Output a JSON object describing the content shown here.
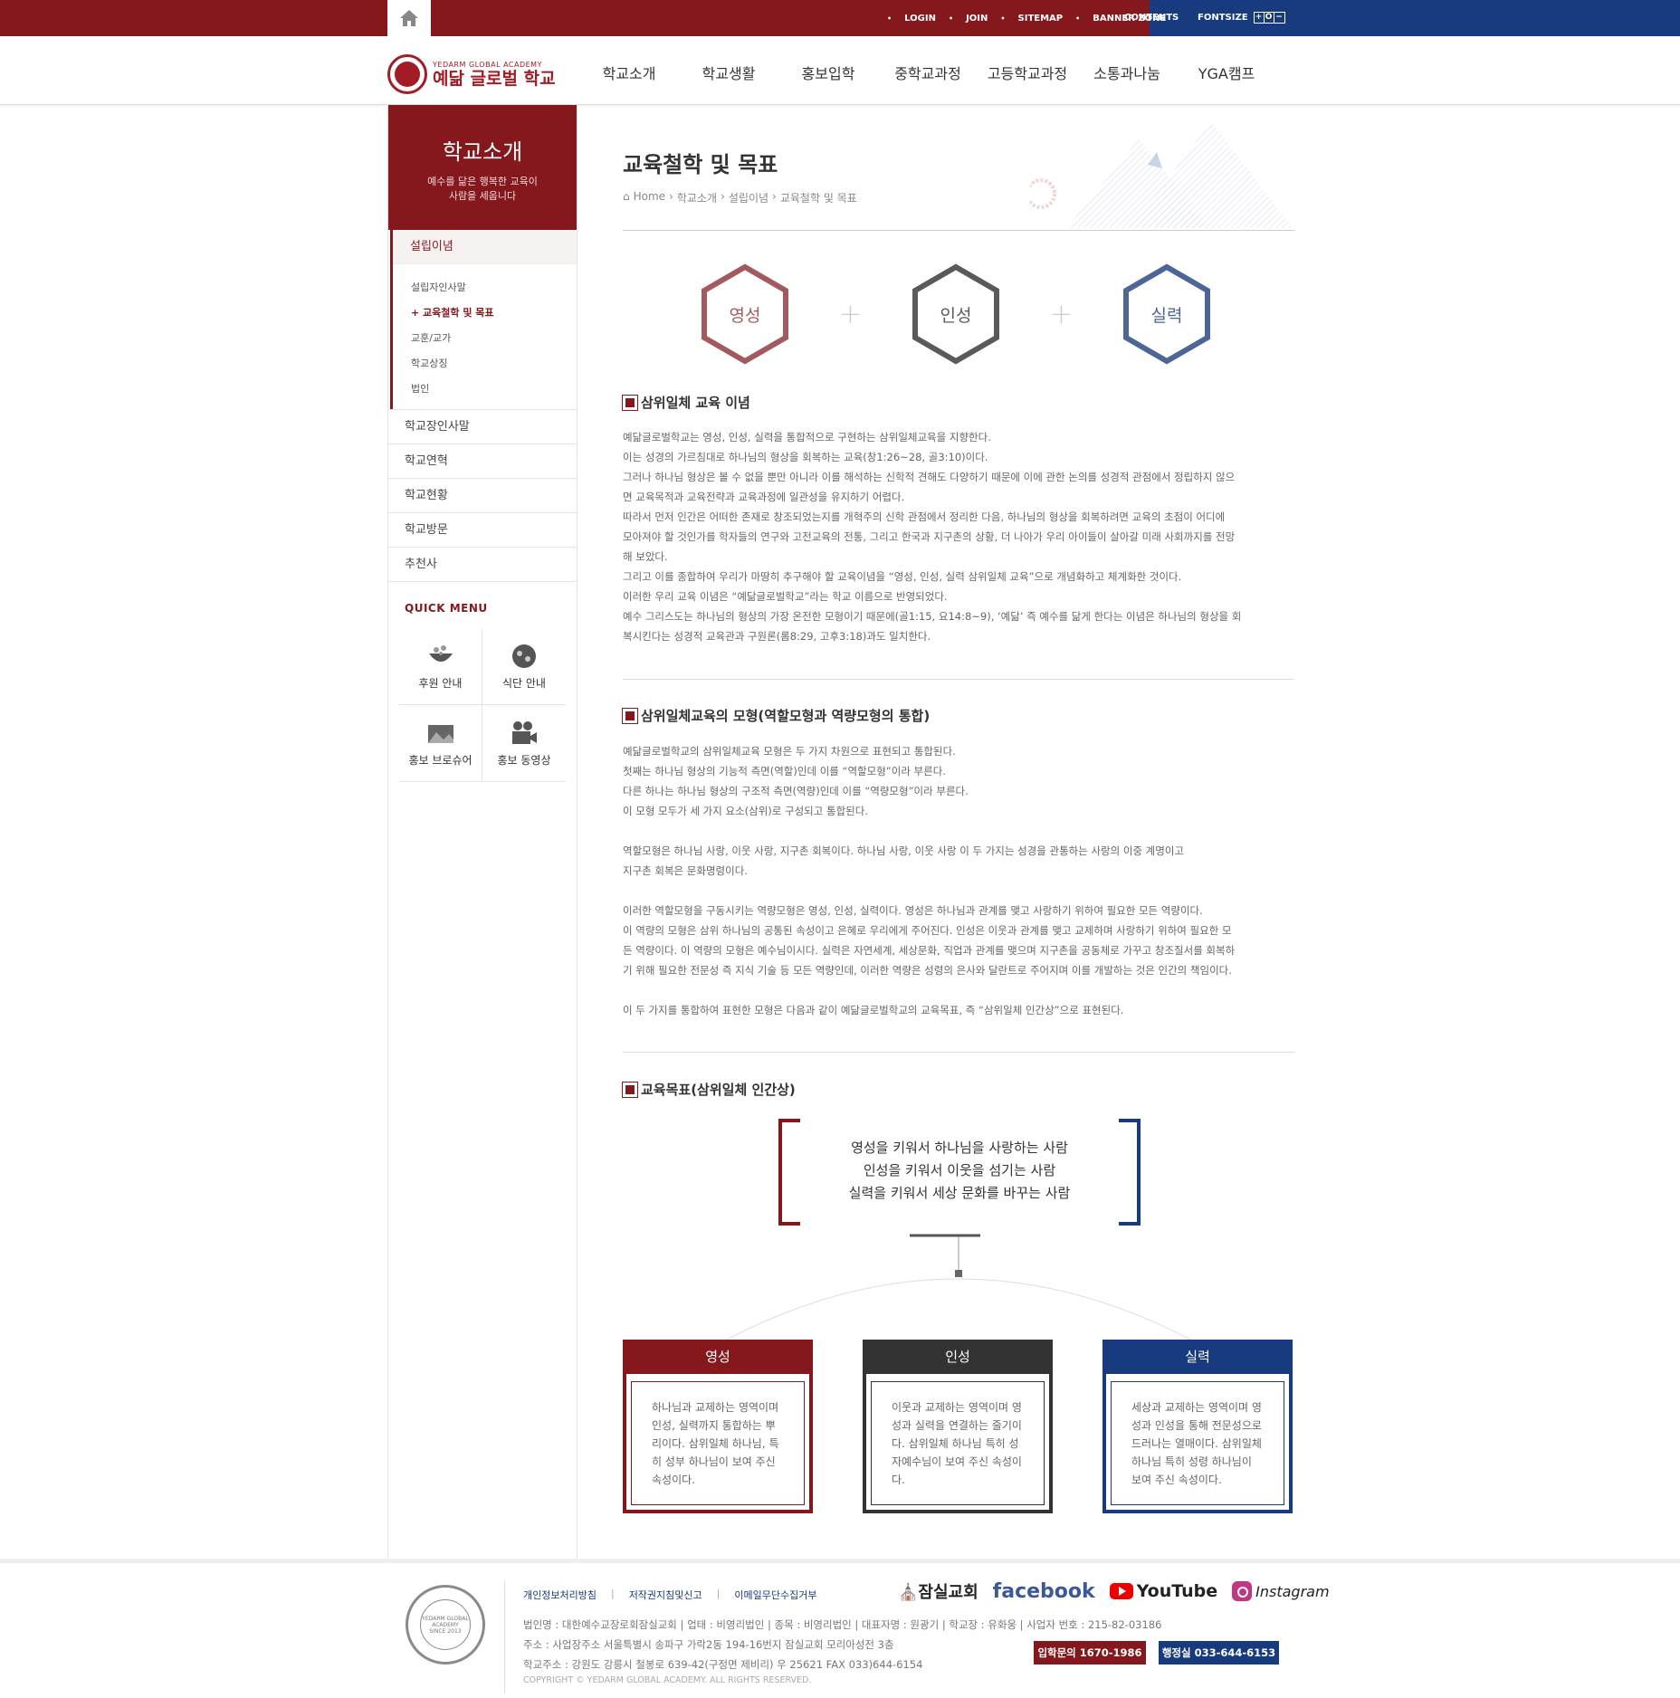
{
  "topbar": {
    "links": [
      "LOGIN",
      "JOIN",
      "SITEMAP",
      "BANNER ZONE"
    ],
    "contents": "CONTENTS",
    "fontsize": "FONTSIZE",
    "fontsize_buttons": [
      "+",
      "O",
      "−"
    ],
    "home_icon": "home-icon"
  },
  "logo": {
    "en": "YEDARM GLOBAL ACADEMY",
    "kr": "예닮 글로벌 학교"
  },
  "gnb": [
    "학교소개",
    "학교생활",
    "홍보입학",
    "중학교과정",
    "고등학교과정",
    "소통과나눔",
    "YGA캠프"
  ],
  "sidebar": {
    "title": "학교소개",
    "subtitle_1": "예수를 닮은 행복한 교육이",
    "subtitle_2": "사람을 세웁니다",
    "active": "설립이념",
    "sub_items": [
      "설립자인사말",
      "+ 교육철학 및 목표",
      "교훈/교가",
      "학교상징",
      "법인"
    ],
    "items": [
      "학교장인사말",
      "학교연혁",
      "학교현황",
      "학교방문",
      "추천사"
    ],
    "quick_title": "QUICK MENU",
    "quick": [
      "후원 안내",
      "식단 안내",
      "홍보 브로슈어",
      "홍보 동영상"
    ]
  },
  "page": {
    "title": "교육철학 및 목표",
    "breadcrumb": [
      "Home",
      "학교소개",
      "설립이념",
      "교육철학 및 목표"
    ]
  },
  "hexagons": [
    {
      "label": "영성",
      "color": "#a35a5e"
    },
    {
      "label": "인성",
      "color": "#5a5a5a"
    },
    {
      "label": "실력",
      "color": "#4d6698"
    }
  ],
  "section1": {
    "title": "삼위일체 교육 이념",
    "lines": [
      "예닮글로벌학교는 영성, 인성, 실력을 통합적으로 구현하는 삼위일체교육을 지향한다.",
      "이는 성경의 가르침대로 하나님의 형상을 회복하는 교육(창1:26~28, 골3:10)이다.",
      "그러나 하나님 형상은 볼 수 없을 뿐만 아니라 이를 해석하는 신학적 견해도 다양하기 때문에 이에 관한 논의를 성경적 관점에서 정립하지 않으",
      "면 교육목적과 교육전략과 교육과정에 일관성을 유지하기 어렵다.",
      "따라서 먼저 인간은 어떠한 존재로 창조되었는지를 개혁주의 신학 관점에서 정리한 다음, 하나님의 형상을 회복하려면 교육의 초점이 어디에",
      "모아져야 할 것인가를 학자들의 연구와 고전교육의 전통, 그리고 한국과 지구촌의 상황, 더 나아가 우리 아이들이 살아갈 미래 사회까지를 전망",
      "해 보았다.",
      "그리고 이를 종합하여 우리가 마땅히 추구해야 할 교육이념을 “영성, 인성, 실력 삼위일체 교육”으로 개념화하고 체계화한 것이다.",
      "이러한 우리 교육 이념은 “예닮글로벌학교”라는 학교 이름으로 반영되었다.",
      "예수 그리스도는 하나님의 형상의 가장 온전한 모형이기 때문에(골1:15, 요14:8~9), ‘예닮’ 즉 예수를 닮게 한다는 이념은 하나님의 형상을 회",
      "복시킨다는 성경적 교육관과 구원론(롬8:29, 고후3:18)과도 일치한다."
    ]
  },
  "section2": {
    "title": "삼위일체교육의 모형(역할모형과 역량모형의 통합)",
    "lines": [
      "예닮글로벌학교의 삼위일체교육 모형은 두 가지 차원으로 표현되고 통합된다.",
      "첫째는 하나님 형상의 기능적 측면(역할)인데 이를 “역할모형”이라 부른다.",
      "다른 하나는 하나님 형상의 구조적 측면(역량)인데 이를 “역량모형”이라 부른다.",
      "이 모형 모두가 세 가지 요소(삼위)로 구성되고 통합된다.",
      "",
      "역할모형은 하나님 사랑, 이웃 사랑, 지구촌 회복이다. 하나님 사랑, 이웃 사랑 이 두 가지는 성경을 관통하는 사랑의 이중 계명이고",
      "지구촌 회복은 문화명령이다.",
      "",
      "이러한 역할모형을 구동시키는 역량모형은 영성, 인성, 실력이다. 영성은 하나님과 관계를 맺고 사랑하기 위하여 필요한 모든 역량이다.",
      "이 역량의 모형은 삼위 하나님의 공통된 속성이고 은혜로 우리에게 주어진다. 인성은 이웃과 관계를 맺고 교제하며 사랑하기 위하여 필요한 모",
      "든 역량이다. 이 역량의 모형은 예수님이시다. 실력은 자연세계, 세상문화, 직업과 관계를 맺으며 지구촌을 공동체로 가꾸고 창조질서를 회복하",
      "기 위해 필요한 전문성 즉 지식 기술 등 모든 역량인데, 이러한 역량은 성령의 은사와 달란트로 주어지며 이를 개발하는 것은 인간의 책임이다.",
      "",
      "이 두 가지를 통합하여 표현한 모형은 다음과 같이 예닮글로벌학교의 교육목표, 즉 “삼위일체 인간상”으로 표현된다."
    ]
  },
  "section3": {
    "title": "교육목표(삼위일체 인간상)",
    "goals": [
      "영성을 키워서 하나님을 사랑하는 사람",
      "인성을 키워서 이웃을 섬기는 사람",
      "실력을 키워서 세상 문화를 바꾸는 사람"
    ],
    "cards": [
      {
        "title": "영성",
        "color": "#85181d",
        "text": "하나님과 교제하는 영역이며 인성, 실력까지 통합하는 뿌리이다. 삼위일체 하나님, 특히 성부 하나님이 보여 주신 속성이다."
      },
      {
        "title": "인성",
        "color": "#333333",
        "text": "이웃과 교제하는 영역이며 영성과 실력을 연결하는 줄기이다. 삼위일체 하나님 특히 성자예수님이 보여 주신 속성이다."
      },
      {
        "title": "실력",
        "color": "#173b7e",
        "text": "세상과 교제하는 영역이며 영성과 인성을 통해 전문성으로 드러나는 열매이다. 삼위일체 하나님 특히 성령 하나님이 보여 주신 속성이다."
      }
    ]
  },
  "footer": {
    "links": [
      "개인정보처리방침",
      "저작권지침및신고",
      "이메일무단수집거부"
    ],
    "info1": "법인명 : 대한예수교장로회잠실교회   |   업태 : 비영리법인   |   종목 : 비영리법인   |   대표자명 : 원광기   |   학교장 : 유화웅   |   사업자 번호 : 215-82-03186",
    "info2": "주소 : 사업장주소 서울특별시 송파구 가락2동 194-16번지 잠실교회 모리아성전 3층",
    "info3": "학교주소 : 강원도 강릉시 철봉로 639-42(구정면 제비리) 우 25621 FAX 033)644-6154",
    "copyright": "COPYRIGHT © YEDARM GLOBAL ACADEMY. ALL RIGHTS RESERVED.",
    "sns": [
      "잠실교회",
      "facebook",
      "YouTube",
      "Instagram"
    ],
    "tel_admission": "입학문의 1670-1986",
    "tel_admin": "행정실 033-644-6153",
    "emblem_text": "YEDARM GLOBAL ACADEMY",
    "emblem_since": "SINCE 2013"
  }
}
